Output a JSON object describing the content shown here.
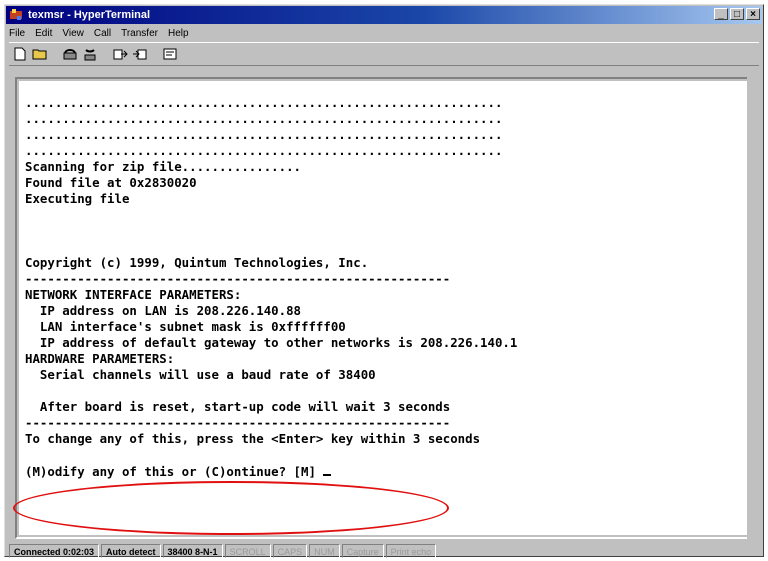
{
  "window": {
    "title": "texmsr - HyperTerminal",
    "buttons": [
      "minimize",
      "maximize",
      "close"
    ]
  },
  "menu": [
    "File",
    "Edit",
    "View",
    "Call",
    "Transfer",
    "Help"
  ],
  "toolbar": {
    "icons": [
      "new-document-icon",
      "open-folder-icon",
      "connect-phone-icon",
      "disconnect-phone-icon",
      "send-file-icon",
      "receive-file-icon",
      "properties-icon"
    ]
  },
  "terminal": {
    "lines": [
      "................................................................",
      "................................................................",
      "................................................................",
      "................................................................",
      "Scanning for zip file................",
      "Found file at 0x2830020",
      "Executing file",
      "",
      "",
      "",
      "Copyright (c) 1999, Quintum Technologies, Inc.",
      "---------------------------------------------------------",
      "NETWORK INTERFACE PARAMETERS:",
      "  IP address on LAN is 208.226.140.88",
      "  LAN interface's subnet mask is 0xffffff00",
      "  IP address of default gateway to other networks is 208.226.140.1",
      "HARDWARE PARAMETERS:",
      "  Serial channels will use a baud rate of 38400",
      "",
      "  After board is reset, start-up code will wait 3 seconds",
      "---------------------------------------------------------",
      "To change any of this, press the <Enter> key within 3 seconds",
      "",
      "(M)odify any of this or (C)ontinue? [M] "
    ]
  },
  "status": {
    "connected": "Connected 0:02:03",
    "detect": "Auto detect",
    "settings": "38400 8-N-1",
    "scroll": "SCROLL",
    "caps": "CAPS",
    "num": "NUM",
    "capture": "Capture",
    "print_echo": "Print echo"
  },
  "colors": {
    "title_bar": "#000080",
    "highlight": "#e01010"
  }
}
